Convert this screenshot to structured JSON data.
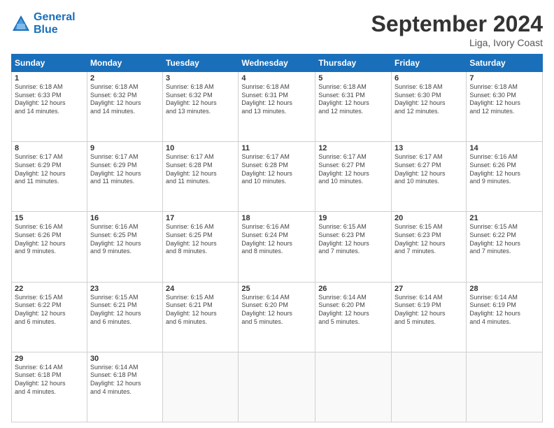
{
  "header": {
    "logo_line1": "General",
    "logo_line2": "Blue",
    "month_title": "September 2024",
    "location": "Liga, Ivory Coast"
  },
  "weekdays": [
    "Sunday",
    "Monday",
    "Tuesday",
    "Wednesday",
    "Thursday",
    "Friday",
    "Saturday"
  ],
  "weeks": [
    [
      {
        "day": "1",
        "info": "Sunrise: 6:18 AM\nSunset: 6:33 PM\nDaylight: 12 hours\nand 14 minutes."
      },
      {
        "day": "2",
        "info": "Sunrise: 6:18 AM\nSunset: 6:32 PM\nDaylight: 12 hours\nand 14 minutes."
      },
      {
        "day": "3",
        "info": "Sunrise: 6:18 AM\nSunset: 6:32 PM\nDaylight: 12 hours\nand 13 minutes."
      },
      {
        "day": "4",
        "info": "Sunrise: 6:18 AM\nSunset: 6:31 PM\nDaylight: 12 hours\nand 13 minutes."
      },
      {
        "day": "5",
        "info": "Sunrise: 6:18 AM\nSunset: 6:31 PM\nDaylight: 12 hours\nand 12 minutes."
      },
      {
        "day": "6",
        "info": "Sunrise: 6:18 AM\nSunset: 6:30 PM\nDaylight: 12 hours\nand 12 minutes."
      },
      {
        "day": "7",
        "info": "Sunrise: 6:18 AM\nSunset: 6:30 PM\nDaylight: 12 hours\nand 12 minutes."
      }
    ],
    [
      {
        "day": "8",
        "info": "Sunrise: 6:17 AM\nSunset: 6:29 PM\nDaylight: 12 hours\nand 11 minutes."
      },
      {
        "day": "9",
        "info": "Sunrise: 6:17 AM\nSunset: 6:29 PM\nDaylight: 12 hours\nand 11 minutes."
      },
      {
        "day": "10",
        "info": "Sunrise: 6:17 AM\nSunset: 6:28 PM\nDaylight: 12 hours\nand 11 minutes."
      },
      {
        "day": "11",
        "info": "Sunrise: 6:17 AM\nSunset: 6:28 PM\nDaylight: 12 hours\nand 10 minutes."
      },
      {
        "day": "12",
        "info": "Sunrise: 6:17 AM\nSunset: 6:27 PM\nDaylight: 12 hours\nand 10 minutes."
      },
      {
        "day": "13",
        "info": "Sunrise: 6:17 AM\nSunset: 6:27 PM\nDaylight: 12 hours\nand 10 minutes."
      },
      {
        "day": "14",
        "info": "Sunrise: 6:16 AM\nSunset: 6:26 PM\nDaylight: 12 hours\nand 9 minutes."
      }
    ],
    [
      {
        "day": "15",
        "info": "Sunrise: 6:16 AM\nSunset: 6:26 PM\nDaylight: 12 hours\nand 9 minutes."
      },
      {
        "day": "16",
        "info": "Sunrise: 6:16 AM\nSunset: 6:25 PM\nDaylight: 12 hours\nand 9 minutes."
      },
      {
        "day": "17",
        "info": "Sunrise: 6:16 AM\nSunset: 6:25 PM\nDaylight: 12 hours\nand 8 minutes."
      },
      {
        "day": "18",
        "info": "Sunrise: 6:16 AM\nSunset: 6:24 PM\nDaylight: 12 hours\nand 8 minutes."
      },
      {
        "day": "19",
        "info": "Sunrise: 6:15 AM\nSunset: 6:23 PM\nDaylight: 12 hours\nand 7 minutes."
      },
      {
        "day": "20",
        "info": "Sunrise: 6:15 AM\nSunset: 6:23 PM\nDaylight: 12 hours\nand 7 minutes."
      },
      {
        "day": "21",
        "info": "Sunrise: 6:15 AM\nSunset: 6:22 PM\nDaylight: 12 hours\nand 7 minutes."
      }
    ],
    [
      {
        "day": "22",
        "info": "Sunrise: 6:15 AM\nSunset: 6:22 PM\nDaylight: 12 hours\nand 6 minutes."
      },
      {
        "day": "23",
        "info": "Sunrise: 6:15 AM\nSunset: 6:21 PM\nDaylight: 12 hours\nand 6 minutes."
      },
      {
        "day": "24",
        "info": "Sunrise: 6:15 AM\nSunset: 6:21 PM\nDaylight: 12 hours\nand 6 minutes."
      },
      {
        "day": "25",
        "info": "Sunrise: 6:14 AM\nSunset: 6:20 PM\nDaylight: 12 hours\nand 5 minutes."
      },
      {
        "day": "26",
        "info": "Sunrise: 6:14 AM\nSunset: 6:20 PM\nDaylight: 12 hours\nand 5 minutes."
      },
      {
        "day": "27",
        "info": "Sunrise: 6:14 AM\nSunset: 6:19 PM\nDaylight: 12 hours\nand 5 minutes."
      },
      {
        "day": "28",
        "info": "Sunrise: 6:14 AM\nSunset: 6:19 PM\nDaylight: 12 hours\nand 4 minutes."
      }
    ],
    [
      {
        "day": "29",
        "info": "Sunrise: 6:14 AM\nSunset: 6:18 PM\nDaylight: 12 hours\nand 4 minutes."
      },
      {
        "day": "30",
        "info": "Sunrise: 6:14 AM\nSunset: 6:18 PM\nDaylight: 12 hours\nand 4 minutes."
      },
      {
        "day": "",
        "info": ""
      },
      {
        "day": "",
        "info": ""
      },
      {
        "day": "",
        "info": ""
      },
      {
        "day": "",
        "info": ""
      },
      {
        "day": "",
        "info": ""
      }
    ]
  ]
}
